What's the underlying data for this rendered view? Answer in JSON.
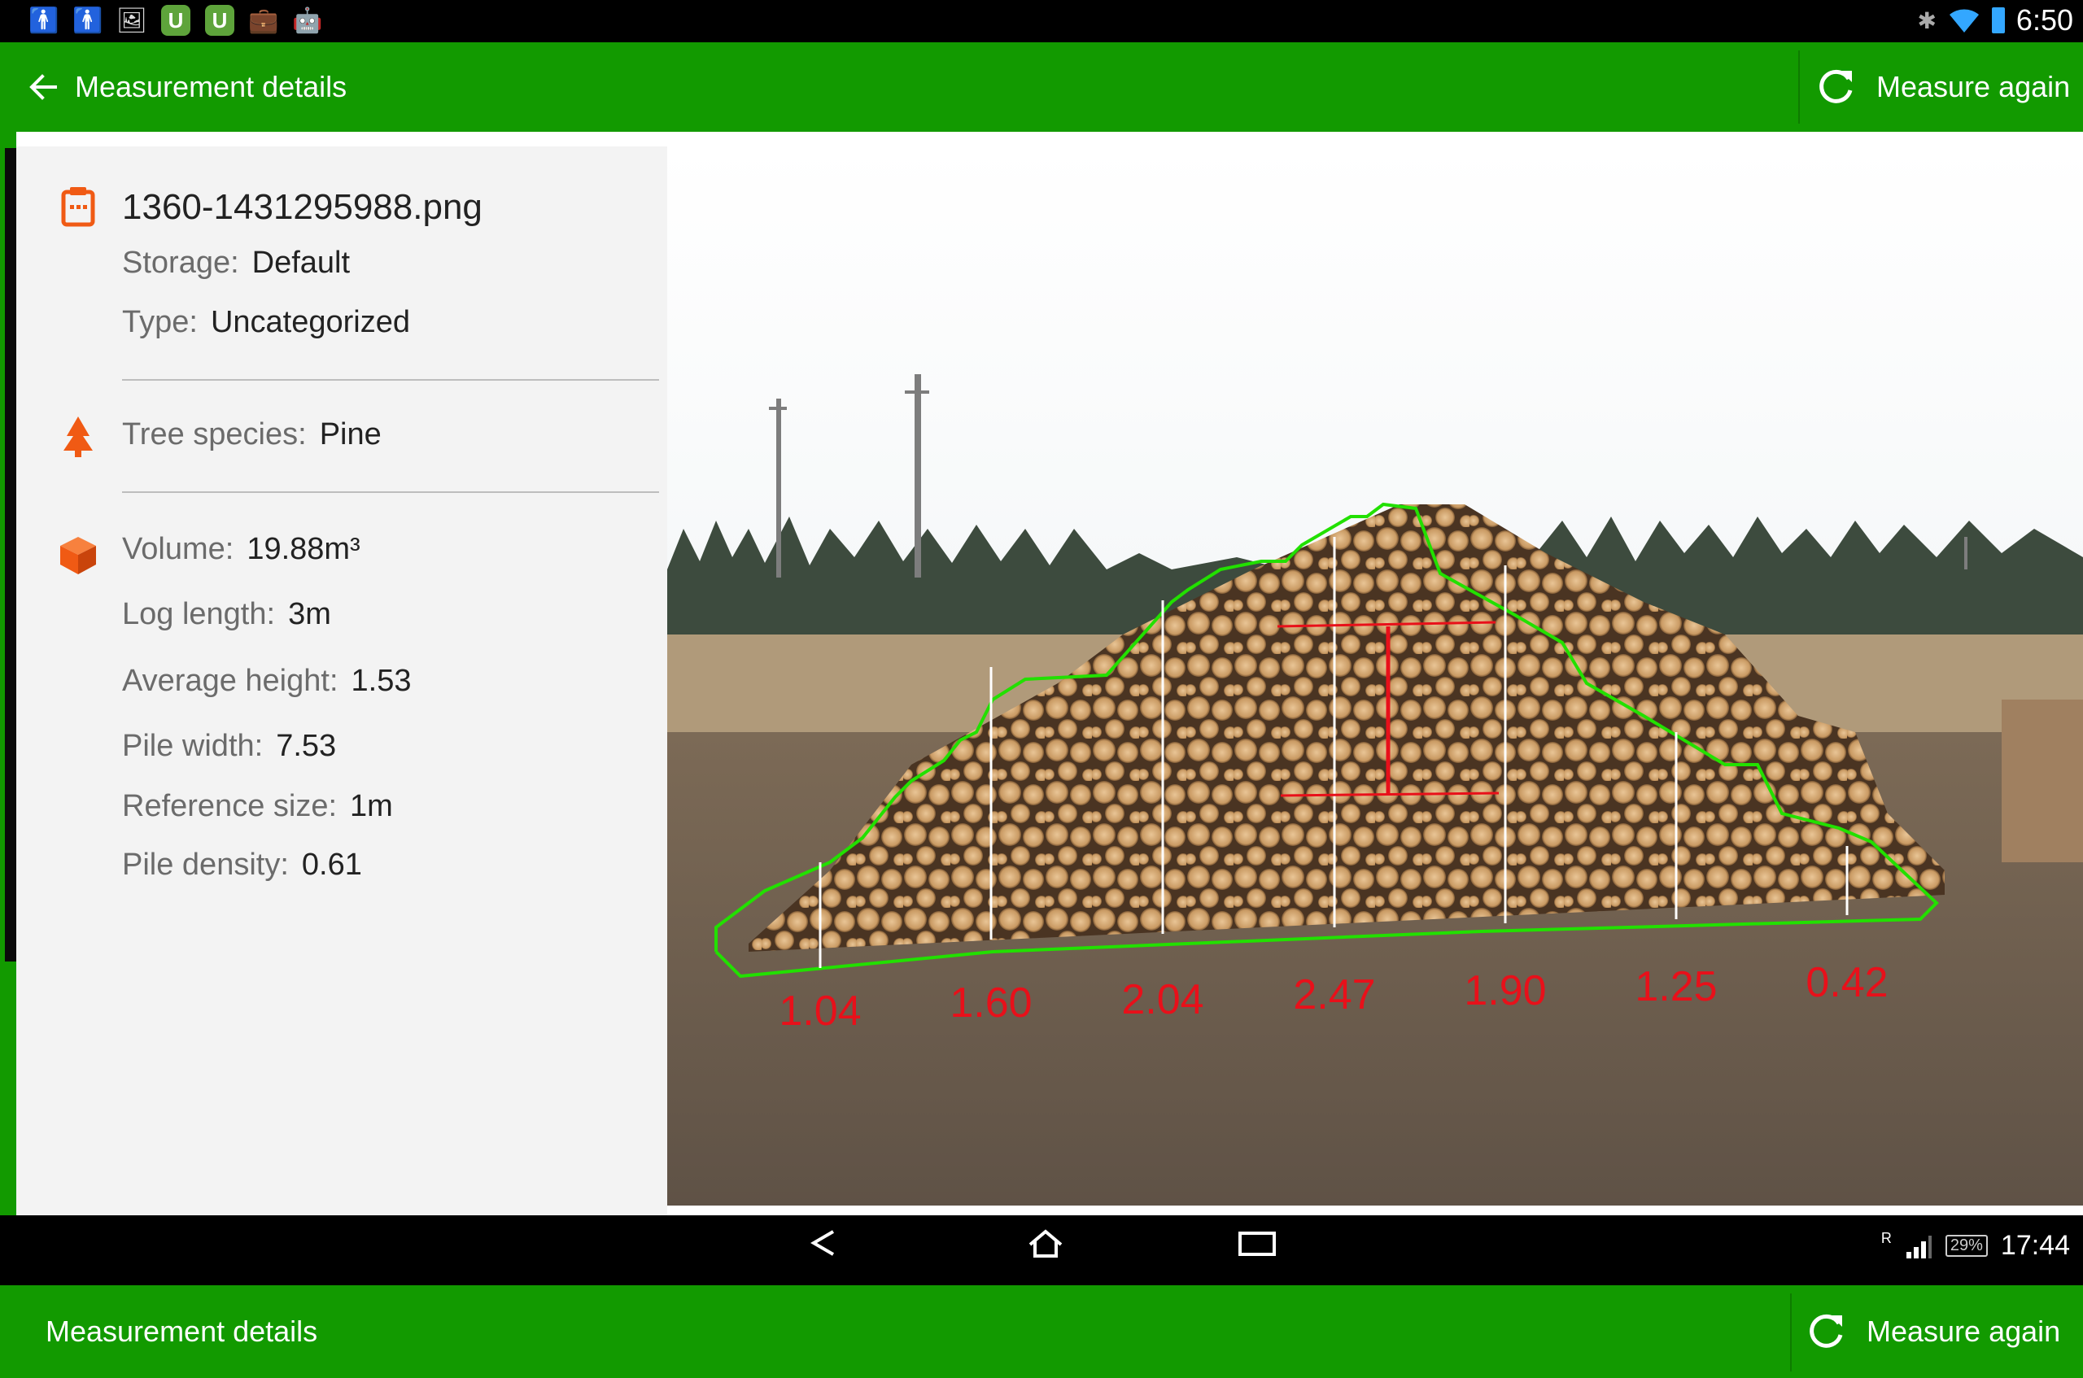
{
  "status_bar": {
    "time": "6:50",
    "left_icons": [
      "person-icon",
      "person-icon",
      "image-icon",
      "u-app-icon",
      "u-app-icon",
      "briefcase-icon",
      "android-icon"
    ],
    "right_icons": [
      "bluetooth-icon",
      "wifi-icon",
      "battery-icon"
    ]
  },
  "app_bar": {
    "title": "Measurement details",
    "action_label": "Measure again"
  },
  "details": {
    "filename": "1360-1431295988.png",
    "storage_label": "Storage:",
    "storage_value": "Default",
    "type_label": "Type:",
    "type_value": "Uncategorized",
    "species_label": "Tree species:",
    "species_value": "Pine",
    "volume_label": "Volume:",
    "volume_value": "19.88m³",
    "log_length_label": "Log length:",
    "log_length_value": "3m",
    "avg_height_label": "Average height:",
    "avg_height_value": "1.53",
    "pile_width_label": "Pile width:",
    "pile_width_value": "7.53",
    "ref_size_label": "Reference size:",
    "ref_size_value": "1m",
    "density_label": "Pile density:",
    "density_value": "0.61"
  },
  "photo": {
    "height_labels": [
      "1.04",
      "1.60",
      "2.04",
      "2.47",
      "1.90",
      "1.25",
      "0.42"
    ],
    "outline_color": "#22e000",
    "label_color": "#e8101a"
  },
  "nav_bar": {
    "time": "17:44",
    "battery": "29%",
    "signal_badge": "R"
  },
  "colors": {
    "primary": "#129a00",
    "accent": "#f05a14"
  }
}
